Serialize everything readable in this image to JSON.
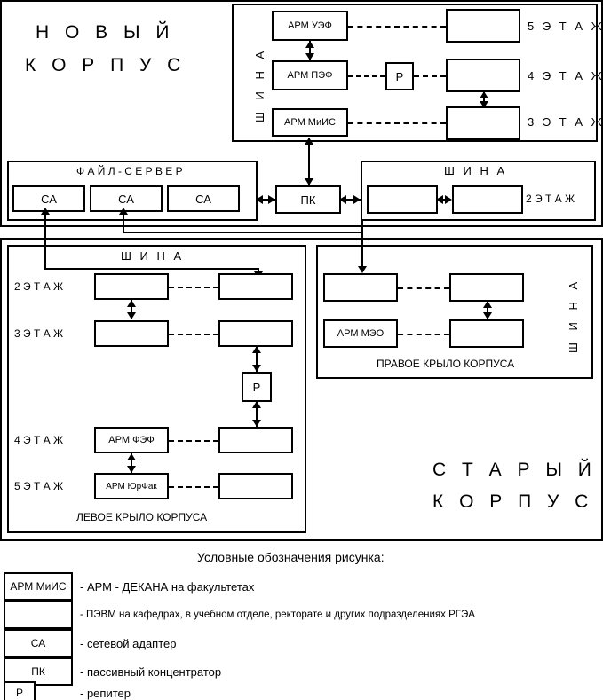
{
  "diagram": {
    "new_building_title_line1": "Н О В Ы Й",
    "new_building_title_line2": "К О Р П У С",
    "old_building_title_line1": "С Т А Р Ы Й",
    "old_building_title_line2": "К О Р П У С"
  },
  "new_building_bus": {
    "bus_label": "Ш И Н А",
    "rows": [
      {
        "arm": "АРМ УЭФ",
        "floor": "5 Э Т А Ж",
        "repeater": ""
      },
      {
        "arm": "АРМ ПЭФ",
        "floor": "4 Э Т А Ж",
        "repeater": "Р"
      },
      {
        "arm": "АРМ МиИС",
        "floor": "3 Э Т А Ж",
        "repeater": ""
      }
    ]
  },
  "file_server": {
    "title": "Ф А Й Л - С Е Р В Е Р",
    "adapters": [
      "СА",
      "СА",
      "СА"
    ]
  },
  "hub": {
    "label": "ПК"
  },
  "floor2_bus": {
    "bus_label": "Ш И Н А",
    "floor": "2 Э Т А Ж",
    "nodes": [
      "",
      ""
    ]
  },
  "left_wing": {
    "bus_label": "Ш И Н А",
    "caption": "ЛЕВОЕ КРЫЛО КОРПУСА",
    "repeater": "Р",
    "rows": [
      {
        "floor": "2 Э Т А Ж",
        "arm": "",
        "pc": ""
      },
      {
        "floor": "3 Э Т А Ж",
        "arm": "",
        "pc": ""
      },
      {
        "floor": "4 Э Т А Ж",
        "arm": "АРМ ФЭФ",
        "pc": ""
      },
      {
        "floor": "5 Э Т А Ж",
        "arm": "АРМ ЮрФак",
        "pc": ""
      }
    ]
  },
  "right_wing": {
    "bus_label": "Ш И Н А",
    "caption": "ПРАВОЕ КРЫЛО КОРПУСА",
    "rows": [
      {
        "arm": "",
        "pc": ""
      },
      {
        "arm": "АРМ МЭО",
        "pc": ""
      }
    ]
  },
  "legend": {
    "title": "Условные обозначения рисунка:",
    "items": [
      {
        "box": "АРМ МиИС",
        "text": "- АРМ - ДЕКАНА на факультетах"
      },
      {
        "box": "",
        "text": "- ПЭВМ на кафедрах, в учебном отделе, ректорате и других подразделениях РГЭА"
      },
      {
        "box": "СА",
        "text": "- сетевой адаптер"
      },
      {
        "box": "ПК",
        "text": "- пассивный концентратор"
      },
      {
        "box": "Р",
        "text": "- репитер"
      }
    ]
  }
}
